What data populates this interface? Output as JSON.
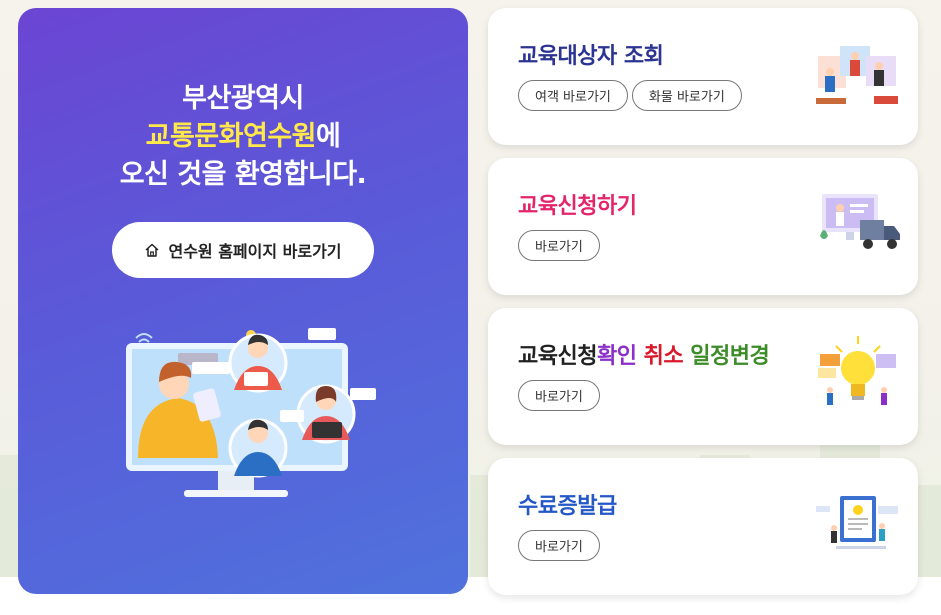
{
  "hero": {
    "title_line1": "부산광역시",
    "title_line2_highlight": "교통문화연수원",
    "title_line2_suffix": "에",
    "title_line3": "오신 것을 환영합니다.",
    "home_button_label": "연수원 홈페이지 바로가기",
    "home_icon": "home-icon",
    "illustration": "online-education-illustration"
  },
  "cards": [
    {
      "title": "교육대상자 조회",
      "buttons": [
        "여객 바로가기",
        "화물 바로가기"
      ],
      "icon": "people-search-icon"
    },
    {
      "title": "교육신청하기",
      "buttons": [
        "바로가기"
      ],
      "icon": "delivery-truck-icon"
    },
    {
      "title_parts": [
        "교육신청",
        "확인",
        "취소",
        "일정변경"
      ],
      "buttons": [
        "바로가기"
      ],
      "icon": "lightbulb-icon"
    },
    {
      "title": "수료증발급",
      "buttons": [
        "바로가기"
      ],
      "icon": "certificate-icon"
    }
  ],
  "colors": {
    "hero_gradient_start": "#6b45d3",
    "hero_gradient_end": "#4f72dd",
    "highlight_yellow": "#ffe84a",
    "title_navy": "#2c3491",
    "title_pink": "#e3266a",
    "title_purple": "#8a2fc8",
    "title_red": "#d9182b",
    "title_green": "#3c8c28",
    "title_blue": "#2458c6"
  }
}
